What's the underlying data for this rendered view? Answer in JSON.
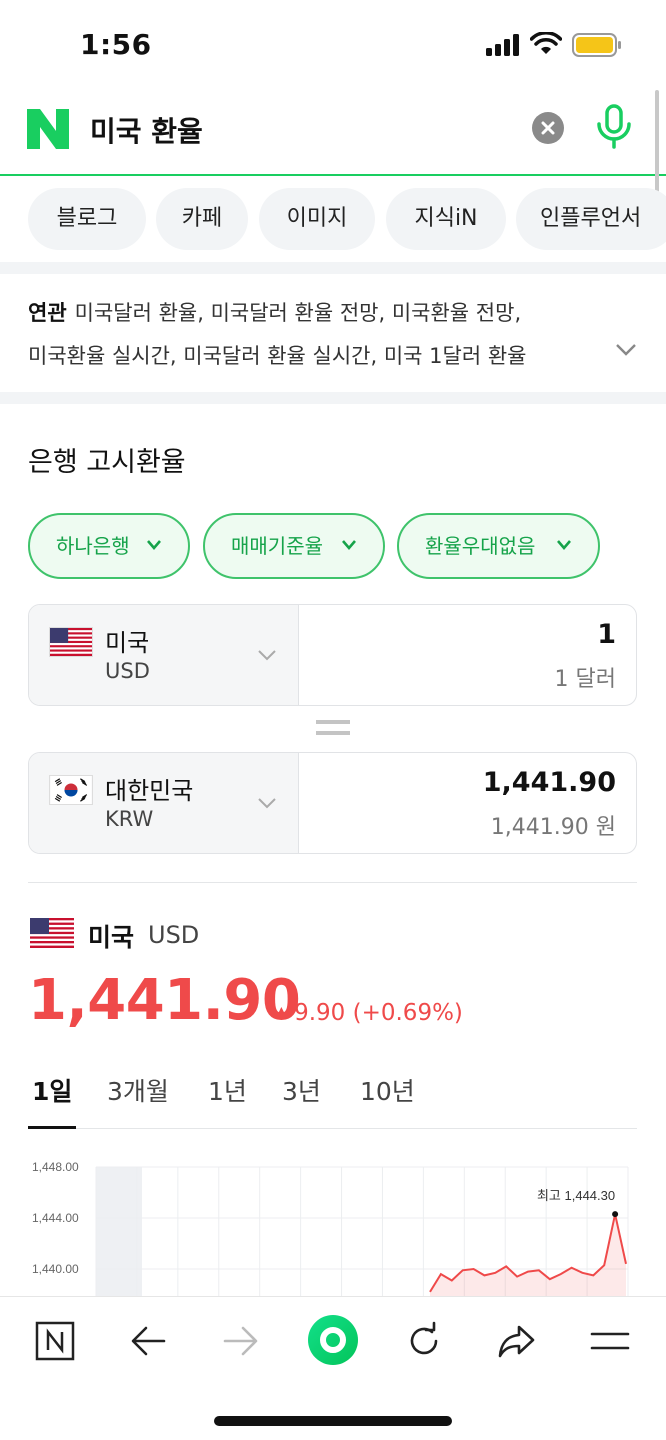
{
  "status": {
    "time": "1:56"
  },
  "search": {
    "query": "미국 환율"
  },
  "tabs": [
    "블로그",
    "카페",
    "이미지",
    "지식iN",
    "인플루언서"
  ],
  "related": {
    "label": "연관",
    "line1": "미국달러 환율, 미국달러 환율 전망, 미국환율 전망,",
    "line2": "미국환율 실시간, 미국달러 환율 실시간, 미국 1달러 환율"
  },
  "exchange": {
    "title": "은행 고시환율",
    "filters": [
      "하나은행",
      "매매기준율",
      "환율우대없음"
    ],
    "from": {
      "name": "미국",
      "code": "USD",
      "amount": "1",
      "amount_text": "1 달러"
    },
    "to": {
      "name": "대한민국",
      "code": "KRW",
      "amount": "1,441.90",
      "amount_text": "1,441.90 원"
    }
  },
  "rate": {
    "name": "미국",
    "code": "USD",
    "value": "1,441.90",
    "change": "9.90 (+0.69%)",
    "direction": "up",
    "color": "#ef4a4a"
  },
  "periods": [
    "1일",
    "3개월",
    "1년",
    "3년",
    "10년"
  ],
  "active_period": "1일",
  "chart_data": {
    "type": "line",
    "title": "",
    "xlabel": "",
    "ylabel": "",
    "y_ticks": [
      "1,448.00",
      "1,444.00",
      "1,440.00"
    ],
    "ylim": [
      1436,
      1448
    ],
    "max_label": "최고 1,444.30",
    "series": [
      {
        "values": [
          1438.2,
          1439.6,
          1439.1,
          1439.9,
          1440.0,
          1439.5,
          1439.7,
          1440.2,
          1439.4,
          1439.8,
          1439.9,
          1439.2,
          1439.6,
          1440.1,
          1439.7,
          1439.5,
          1440.3,
          1444.3,
          1440.4
        ]
      }
    ],
    "color": "#ef4a4a"
  },
  "colors": {
    "brand_green": "#19ce60",
    "up_red": "#ef4a4a"
  }
}
